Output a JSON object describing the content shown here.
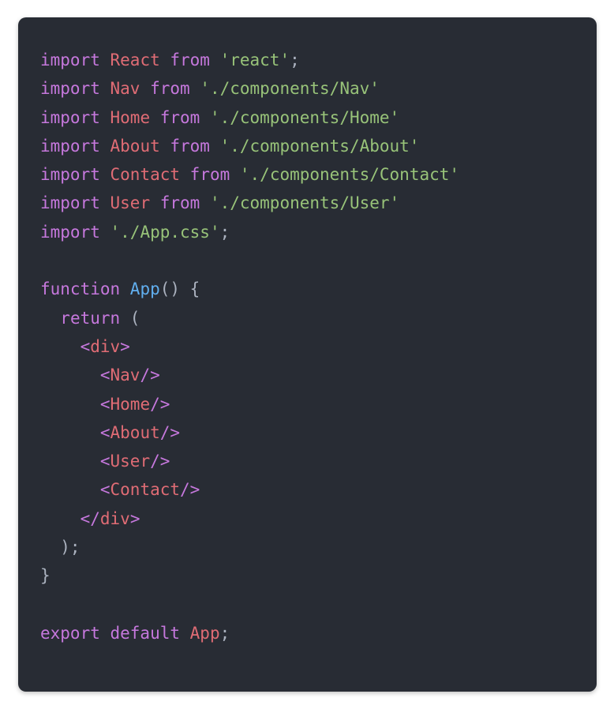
{
  "code": {
    "language": "javascript",
    "filename_hint": "App.js",
    "tokens": [
      [
        {
          "t": "import ",
          "c": "key"
        },
        {
          "t": "React ",
          "c": "class"
        },
        {
          "t": "from ",
          "c": "key"
        },
        {
          "t": "'react'",
          "c": "str"
        },
        {
          "t": ";",
          "c": "punc"
        }
      ],
      [
        {
          "t": "import ",
          "c": "key"
        },
        {
          "t": "Nav ",
          "c": "class"
        },
        {
          "t": "from ",
          "c": "key"
        },
        {
          "t": "'./components/Nav'",
          "c": "str"
        }
      ],
      [
        {
          "t": "import ",
          "c": "key"
        },
        {
          "t": "Home ",
          "c": "class"
        },
        {
          "t": "from ",
          "c": "key"
        },
        {
          "t": "'./components/Home'",
          "c": "str"
        }
      ],
      [
        {
          "t": "import ",
          "c": "key"
        },
        {
          "t": "About ",
          "c": "class"
        },
        {
          "t": "from ",
          "c": "key"
        },
        {
          "t": "'./components/About'",
          "c": "str"
        }
      ],
      [
        {
          "t": "import ",
          "c": "key"
        },
        {
          "t": "Contact ",
          "c": "class"
        },
        {
          "t": "from ",
          "c": "key"
        },
        {
          "t": "'./components/Contact'",
          "c": "str"
        }
      ],
      [
        {
          "t": "import ",
          "c": "key"
        },
        {
          "t": "User ",
          "c": "class"
        },
        {
          "t": "from ",
          "c": "key"
        },
        {
          "t": "'./components/User'",
          "c": "str"
        }
      ],
      [
        {
          "t": "import ",
          "c": "key"
        },
        {
          "t": "'./App.css'",
          "c": "str"
        },
        {
          "t": ";",
          "c": "punc"
        }
      ],
      [],
      [
        {
          "t": "function ",
          "c": "key"
        },
        {
          "t": "App",
          "c": "func"
        },
        {
          "t": "() {",
          "c": "punc"
        }
      ],
      [
        {
          "t": "  ",
          "c": "punc"
        },
        {
          "t": "return",
          "c": "key"
        },
        {
          "t": " (",
          "c": "punc"
        }
      ],
      [
        {
          "t": "    ",
          "c": "punc"
        },
        {
          "t": "<",
          "c": "key"
        },
        {
          "t": "div",
          "c": "class"
        },
        {
          "t": ">",
          "c": "key"
        }
      ],
      [
        {
          "t": "      ",
          "c": "punc"
        },
        {
          "t": "<",
          "c": "key"
        },
        {
          "t": "Nav",
          "c": "class"
        },
        {
          "t": "/>",
          "c": "key"
        }
      ],
      [
        {
          "t": "      ",
          "c": "punc"
        },
        {
          "t": "<",
          "c": "key"
        },
        {
          "t": "Home",
          "c": "class"
        },
        {
          "t": "/>",
          "c": "key"
        }
      ],
      [
        {
          "t": "      ",
          "c": "punc"
        },
        {
          "t": "<",
          "c": "key"
        },
        {
          "t": "About",
          "c": "class"
        },
        {
          "t": "/>",
          "c": "key"
        }
      ],
      [
        {
          "t": "      ",
          "c": "punc"
        },
        {
          "t": "<",
          "c": "key"
        },
        {
          "t": "User",
          "c": "class"
        },
        {
          "t": "/>",
          "c": "key"
        }
      ],
      [
        {
          "t": "      ",
          "c": "punc"
        },
        {
          "t": "<",
          "c": "key"
        },
        {
          "t": "Contact",
          "c": "class"
        },
        {
          "t": "/>",
          "c": "key"
        }
      ],
      [
        {
          "t": "    ",
          "c": "punc"
        },
        {
          "t": "</",
          "c": "key"
        },
        {
          "t": "div",
          "c": "class"
        },
        {
          "t": ">",
          "c": "key"
        }
      ],
      [
        {
          "t": "  );",
          "c": "punc"
        }
      ],
      [
        {
          "t": "}",
          "c": "punc"
        }
      ],
      [],
      [
        {
          "t": "export default ",
          "c": "key"
        },
        {
          "t": "App",
          "c": "class"
        },
        {
          "t": ";",
          "c": "punc"
        }
      ]
    ]
  }
}
